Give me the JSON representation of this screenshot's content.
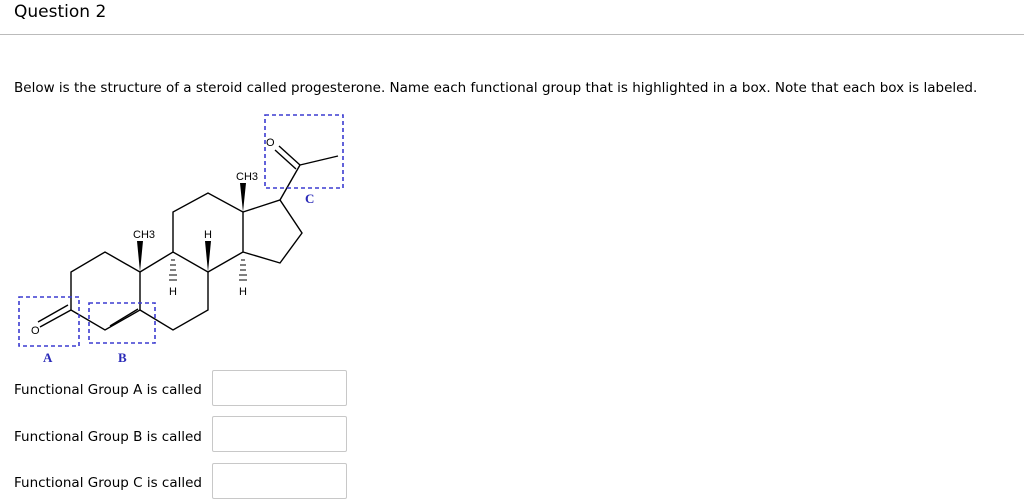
{
  "question_title": "Question 2",
  "prompt": "Below is the structure of a steroid called progesterone. Name each functional group that is highlighted in a box. Note that each box is labeled.",
  "structure": {
    "ch3": "CH3",
    "h": "H",
    "o": "O",
    "box_labels": [
      "A",
      "B",
      "C"
    ],
    "box_color": "#3b3bd0"
  },
  "fields": [
    {
      "label": "Functional Group A is called",
      "value": ""
    },
    {
      "label": "Functional Group B is called",
      "value": ""
    },
    {
      "label": "Functional Group C is called",
      "value": ""
    }
  ]
}
